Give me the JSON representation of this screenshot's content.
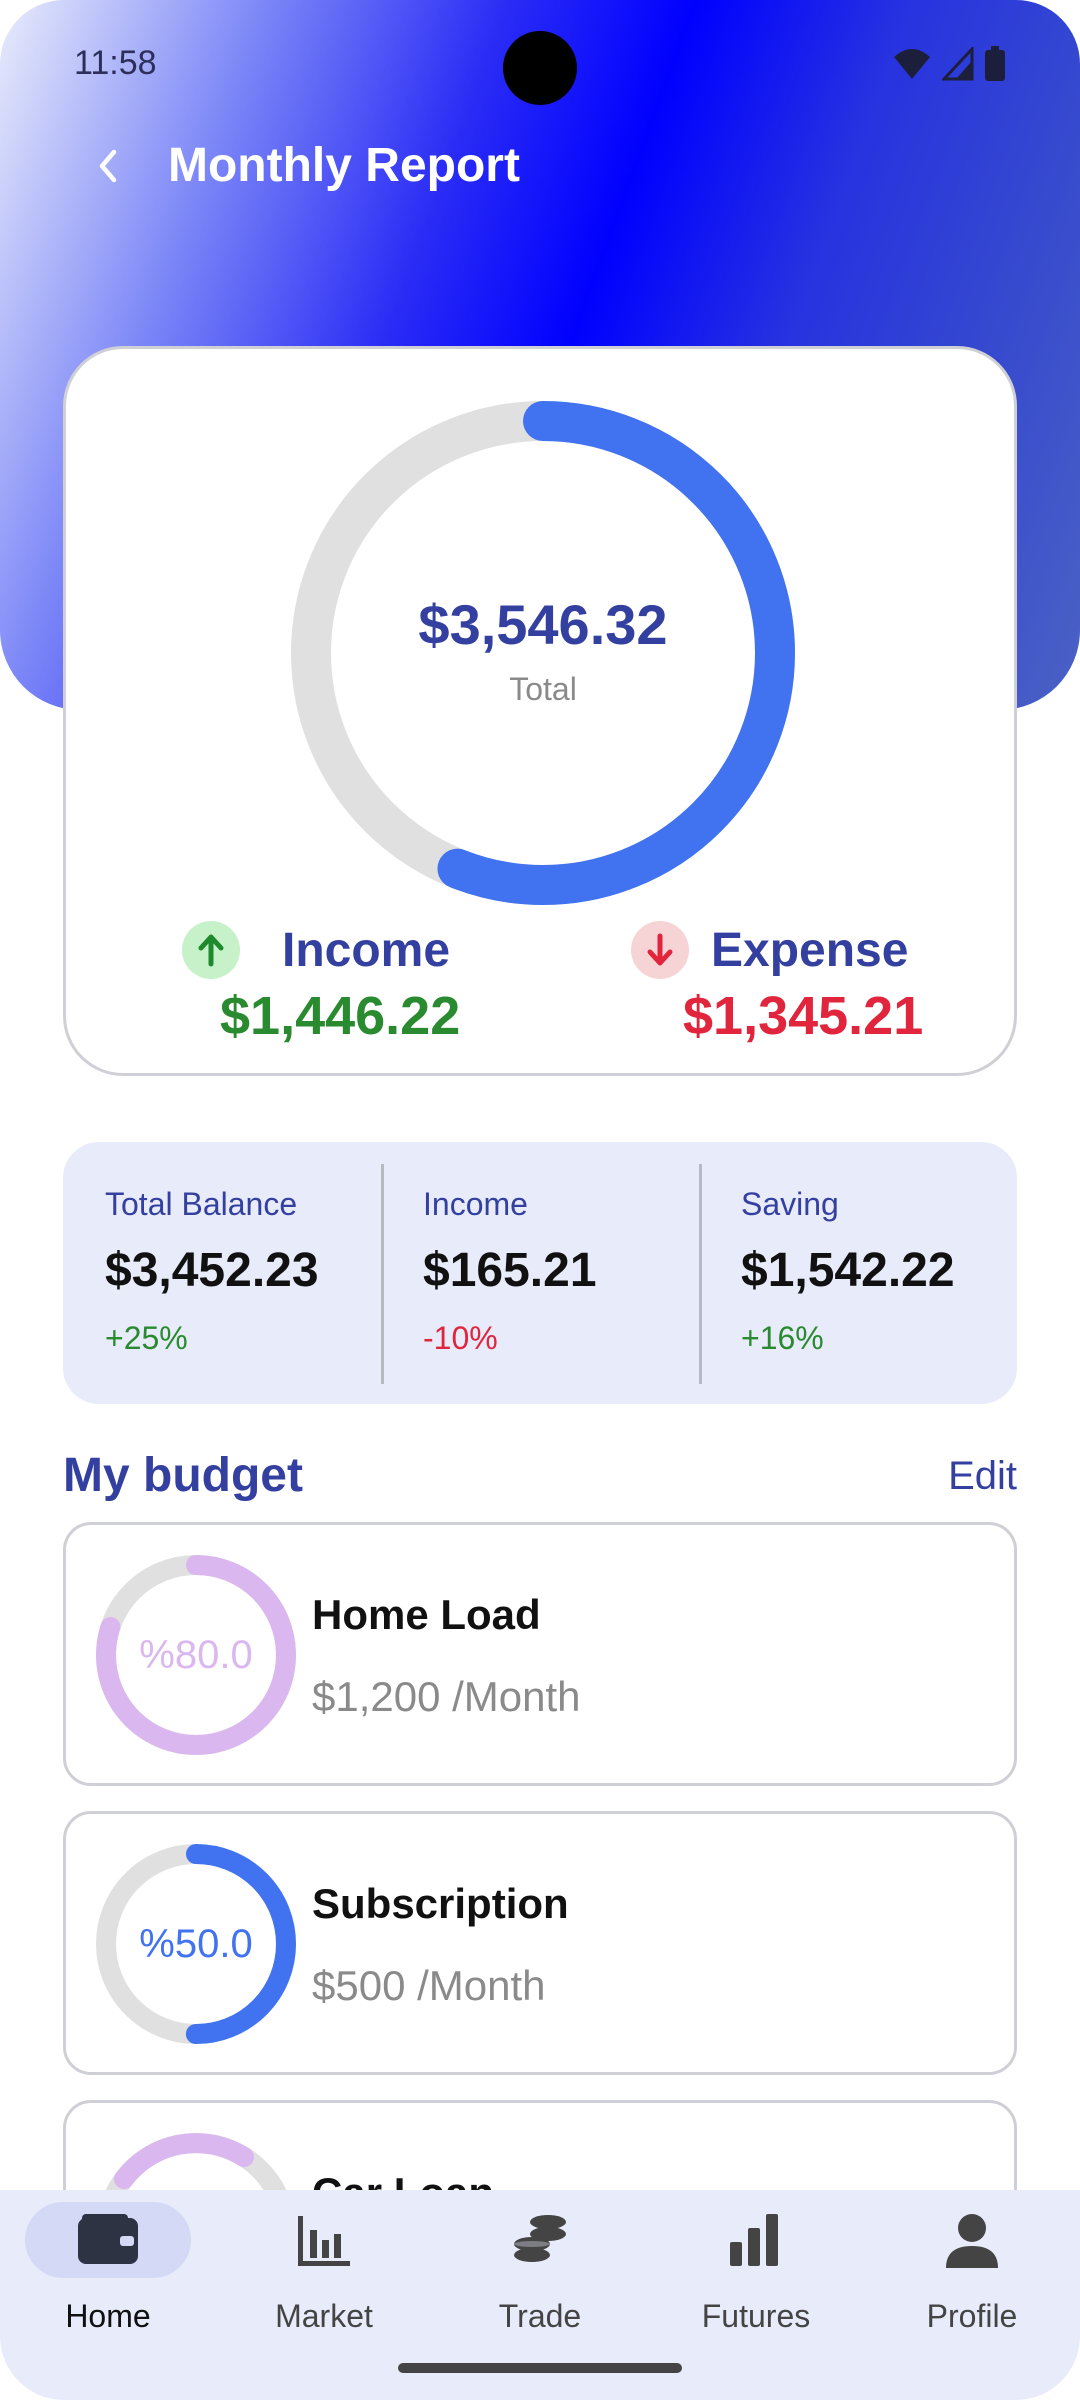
{
  "status_bar": {
    "time": "11:58"
  },
  "header": {
    "title": "Monthly Report"
  },
  "summary": {
    "total_amount": "$3,546.32",
    "total_label": "Total",
    "donut_fraction": 0.56,
    "income_label": "Income",
    "income_value": "$1,446.22",
    "expense_label": "Expense",
    "expense_value": "$1,345.21"
  },
  "stats": [
    {
      "label": "Total Balance",
      "value": "$3,452.23",
      "change": "+25%"
    },
    {
      "label": "Income",
      "value": "$165.21",
      "change": "-10%"
    },
    {
      "label": "Saving",
      "value": "$1,542.22",
      "change": "+16%"
    }
  ],
  "budget": {
    "heading": "My budget",
    "edit_label": "Edit",
    "items": [
      {
        "percent_text": "%80.0",
        "fraction": 0.8,
        "name": "Home Load",
        "amount": "$1,200 /Month"
      },
      {
        "percent_text": "%50.0",
        "fraction": 0.5,
        "name": "Subscription",
        "amount": "$500 /Month"
      },
      {
        "name": "Car Loan"
      }
    ]
  },
  "nav": {
    "items": [
      {
        "label": "Home",
        "icon": "wallet-icon"
      },
      {
        "label": "Market",
        "icon": "bar-chart-icon"
      },
      {
        "label": "Trade",
        "icon": "coins-icon"
      },
      {
        "label": "Futures",
        "icon": "signal-bars-icon"
      },
      {
        "label": "Profile",
        "icon": "person-icon"
      }
    ]
  },
  "colors": {
    "primary": "#3440a0",
    "donut": "#4173f0",
    "donut_track": "#e0e0e0",
    "income": "#2a8a2f",
    "expense": "#e0253c",
    "budget_purple": "#dbb7ef",
    "budget_blue": "#4173f0"
  }
}
